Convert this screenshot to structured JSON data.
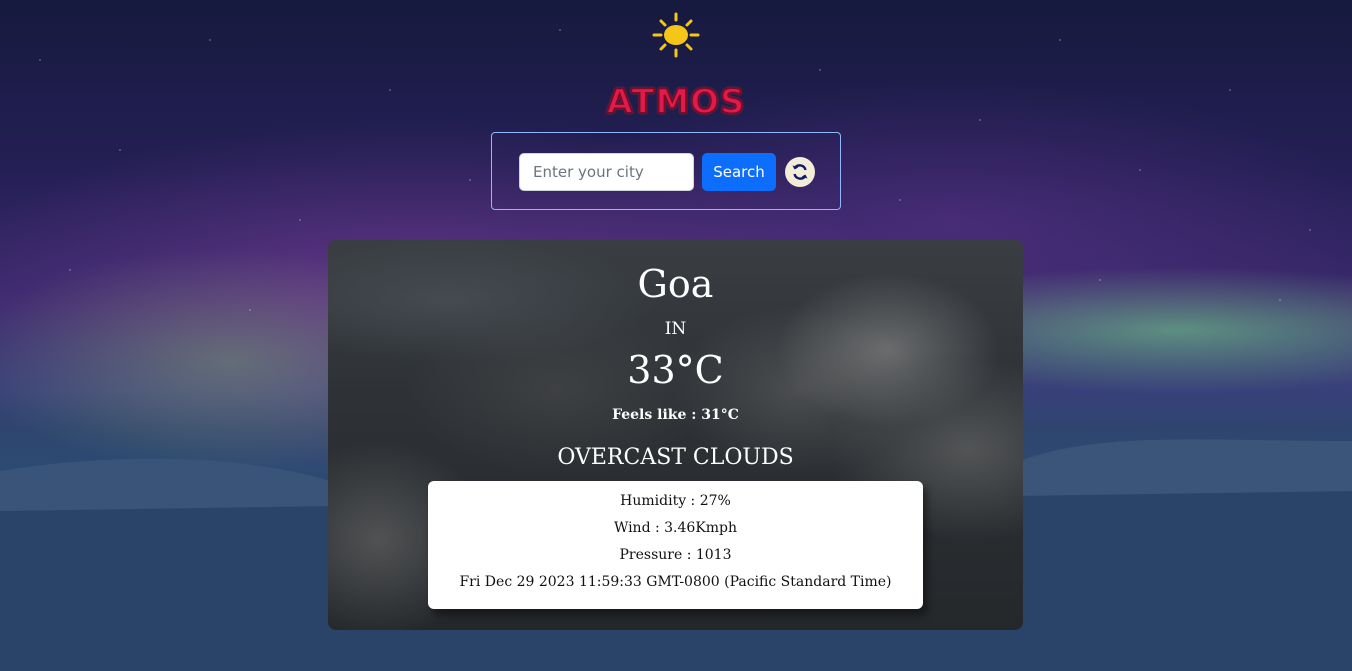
{
  "app": {
    "logo_text": "ATMOS",
    "logo_color": "#e01b4c",
    "sun_icon": "sun-icon"
  },
  "search": {
    "placeholder": "Enter your city",
    "value": "",
    "button_label": "Search",
    "refresh_icon": "refresh-icon",
    "button_color": "#0d6efd"
  },
  "weather": {
    "city": "Goa",
    "country": "IN",
    "temperature": "33°C",
    "feels_like": "Feels like : 31°C",
    "description": "OVERCAST CLOUDS",
    "details": {
      "humidity": "Humidity : 27%",
      "wind": "Wind : 3.46Kmph",
      "pressure": "Pressure : 1013",
      "datetime": "Fri Dec 29 2023 11:59:33 GMT-0800 (Pacific Standard Time)"
    }
  }
}
